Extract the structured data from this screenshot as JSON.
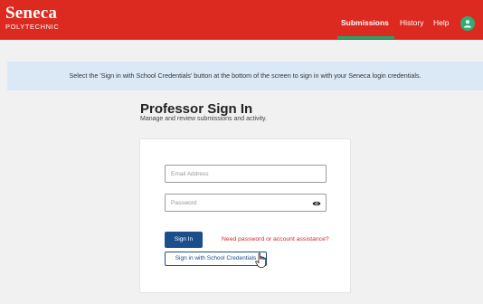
{
  "header": {
    "logo_name": "Seneca",
    "logo_sub": "POLYTECHNIC",
    "nav": [
      {
        "label": "Submissions",
        "active": true
      },
      {
        "label": "History",
        "active": false
      },
      {
        "label": "Help",
        "active": false
      }
    ],
    "avatar_icon": "user-icon"
  },
  "banner": {
    "text": "Select the 'Sign in with School Credentials' button at the bottom of the screen to sign in with your Seneca login credentials."
  },
  "page": {
    "title": "Professor Sign In",
    "subtitle": "Manage and review submissions and activity."
  },
  "form": {
    "email_placeholder": "Email Address",
    "password_placeholder": "Password",
    "password_toggle_icon": "eye-icon",
    "signin_label": "Sign In",
    "help_link": "Need password or account assistance?",
    "school_signin_label": "Sign in with School Credentials"
  },
  "colors": {
    "brand_red": "#dc2a20",
    "nav_active_underline": "#2e9f6a",
    "primary_blue": "#1b4f8c",
    "banner_bg": "#dbe9f6",
    "link_red": "#d6272e"
  }
}
